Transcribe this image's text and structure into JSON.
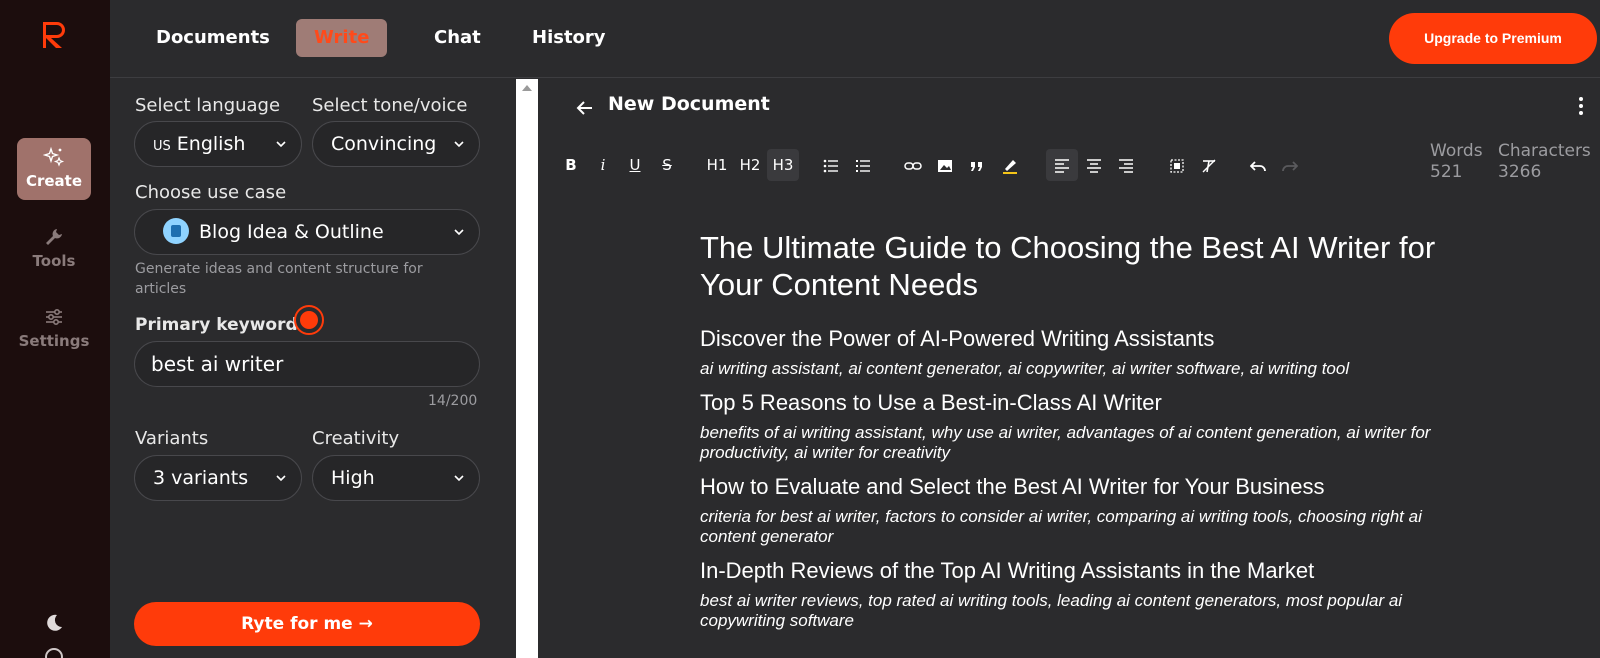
{
  "rail": {
    "items": [
      {
        "label": "Create",
        "icon": "sparkles-icon"
      },
      {
        "label": "Tools",
        "icon": "wrench-icon"
      },
      {
        "label": "Settings",
        "icon": "sliders-icon"
      }
    ],
    "accent": "#ff3b0a"
  },
  "nav": {
    "tabs": [
      {
        "label": "Documents"
      },
      {
        "label": "Write"
      },
      {
        "label": "Chat"
      },
      {
        "label": "History"
      }
    ],
    "upgrade_label": "Upgrade to Premium"
  },
  "form": {
    "language_label": "Select language",
    "language_flag": "US",
    "language_value": "English",
    "tone_label": "Select tone/voice",
    "tone_value": "Convincing",
    "usecase_label": "Choose use case",
    "usecase_value": "Blog Idea & Outline",
    "usecase_hint": "Generate ideas and content structure for articles",
    "keyword_label": "Primary keyword",
    "keyword_value": "best ai writer",
    "keyword_counter": "14/200",
    "variants_label": "Variants",
    "variants_value": "3 variants",
    "creativity_label": "Creativity",
    "creativity_value": "High",
    "submit_label": "Ryte for me →"
  },
  "editor": {
    "title": "New Document",
    "toolbar": {
      "h1": "H1",
      "h2": "H2",
      "h3": "H3"
    },
    "words_label": "Words",
    "words_value": "521",
    "chars_label": "Characters",
    "chars_value": "3266",
    "heading": "The Ultimate Guide to Choosing the Best AI Writer for Your Content Needs",
    "sections": [
      {
        "title": "Discover the Power of AI-Powered Writing Assistants",
        "keywords": "ai writing assistant, ai content generator, ai copywriter, ai writer software, ai writing tool"
      },
      {
        "title": "Top 5 Reasons to Use a Best-in-Class AI Writer",
        "keywords": "benefits of ai writing assistant, why use ai writer, advantages of ai content generation, ai writer for productivity, ai writer for creativity"
      },
      {
        "title": "How to Evaluate and Select the Best AI Writer for Your Business",
        "keywords": "criteria for best ai writer, factors to consider ai writer, comparing ai writing tools, choosing right ai content generator"
      },
      {
        "title": "In-Depth Reviews of the Top AI Writing Assistants in the Market",
        "keywords": "best ai writer reviews, top rated ai writing tools, leading ai content generators, most popular ai copywriting software"
      }
    ]
  }
}
